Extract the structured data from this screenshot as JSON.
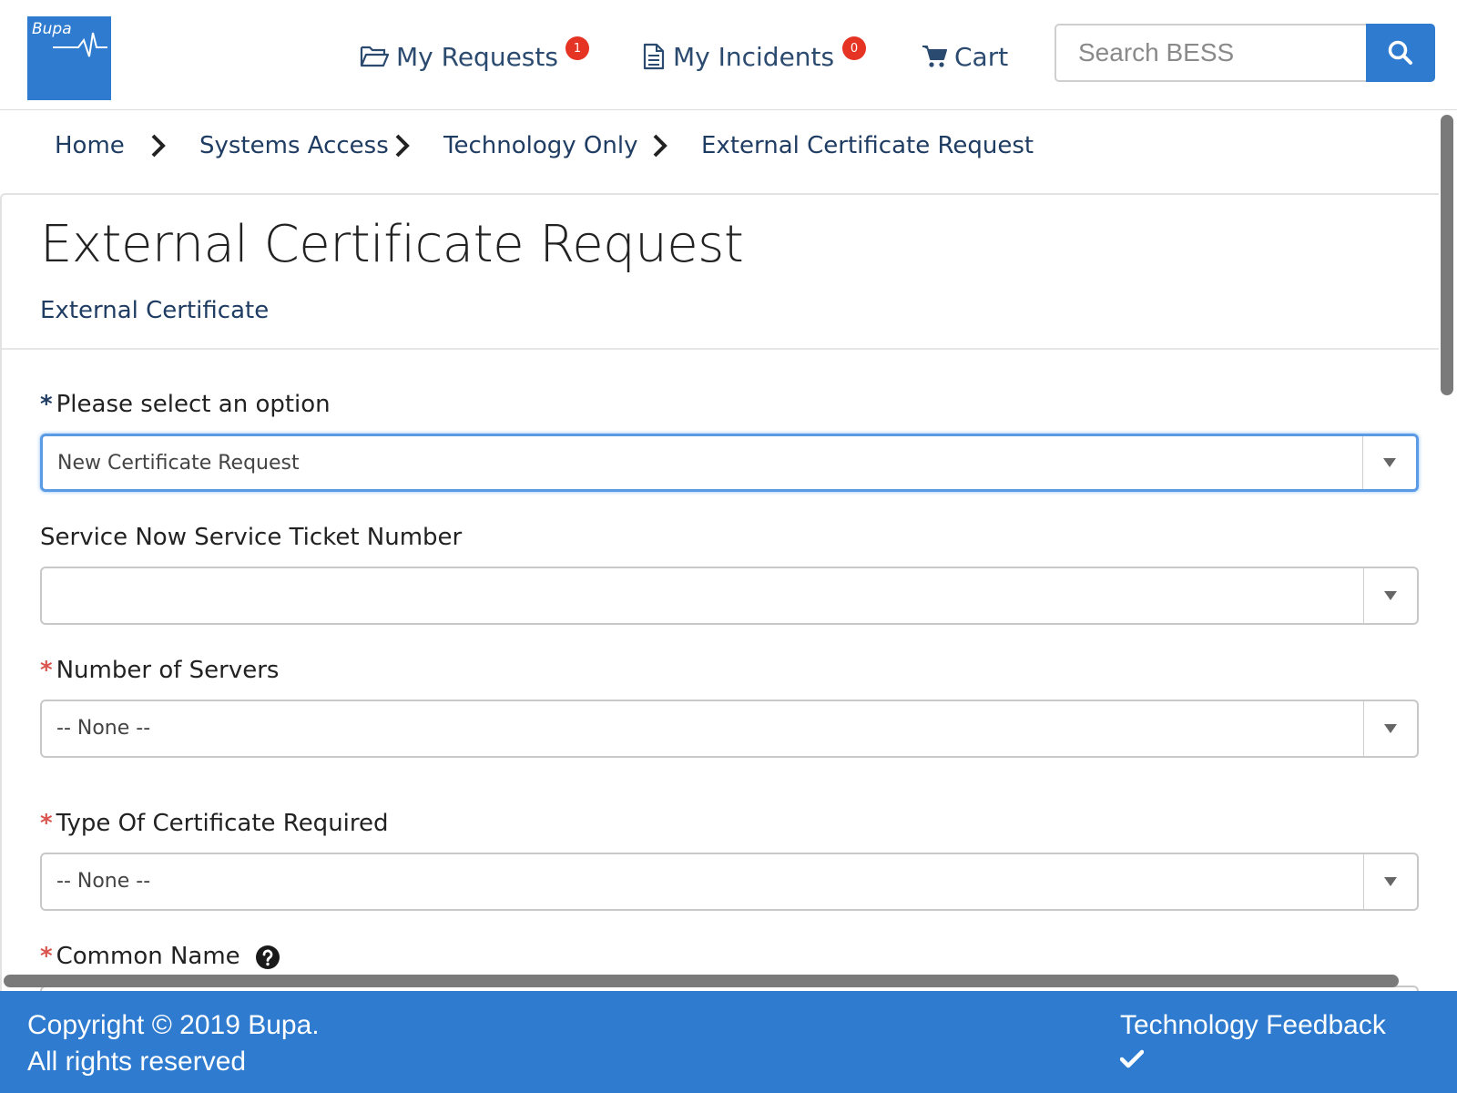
{
  "brand": {
    "logo_text": "Bupa",
    "color": "#2e7bcf"
  },
  "header": {
    "nav": [
      {
        "label": "My Requests",
        "icon": "folder-open-icon",
        "badge": "1"
      },
      {
        "label": "My Incidents",
        "icon": "document-icon",
        "badge": "0"
      },
      {
        "label": "Cart",
        "icon": "cart-icon"
      }
    ],
    "search": {
      "placeholder": "Search BESS",
      "value": "",
      "button_icon": "search-icon"
    }
  },
  "breadcrumb": [
    "Home",
    "Systems Access",
    "Technology Only",
    "External Certificate Request"
  ],
  "page": {
    "title": "External Certificate Request",
    "subtitle": "External Certificate"
  },
  "form": {
    "fields": [
      {
        "label": "Please select an option",
        "required": true,
        "value": "New Certificate Request"
      },
      {
        "label": "Service Now Service Ticket Number",
        "required": false,
        "value": ""
      },
      {
        "label": "Number of Servers",
        "required": true,
        "value": "-- None --"
      },
      {
        "label": "Type Of Certificate Required",
        "required": true,
        "value": "-- None --"
      },
      {
        "label": "Common Name",
        "required": true,
        "help_icon": "question-circle-icon"
      }
    ],
    "required_marker": "*"
  },
  "footer": {
    "copyright_line1": "Copyright © 2019 Bupa.",
    "copyright_line2": "All rights reserved",
    "feedback_label": "Technology Feedback",
    "feedback_icon": "check-icon"
  },
  "colors": {
    "badge": "#e53324",
    "link": "#1f3c63",
    "required_red": "#d9534f",
    "focus": "#5b9be6"
  }
}
